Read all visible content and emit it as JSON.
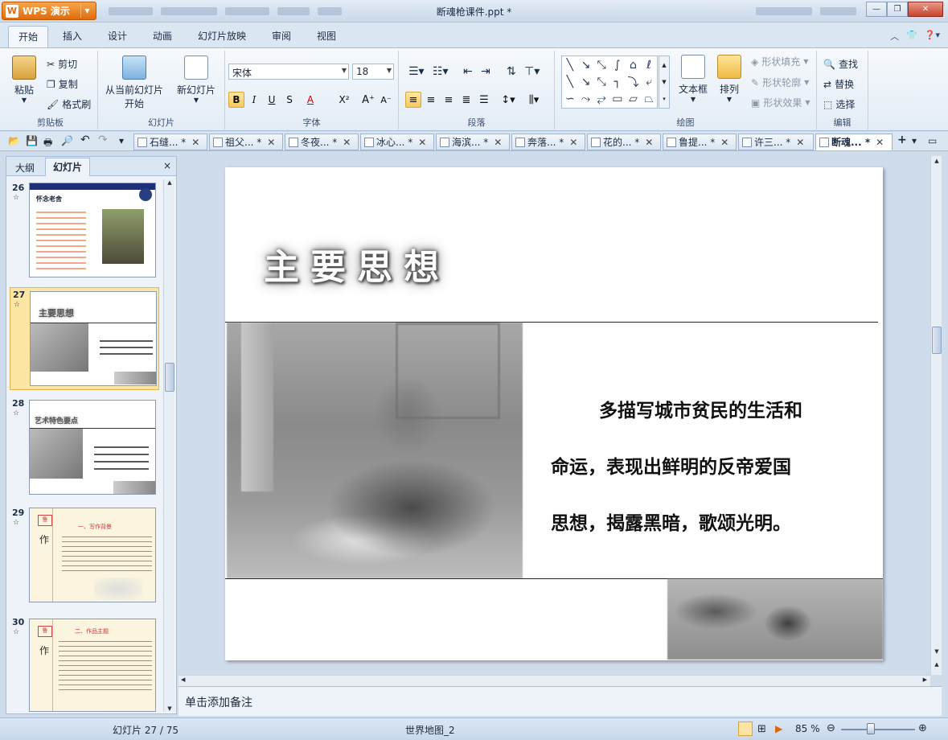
{
  "titlebar": {
    "app_button": "WPS 演示",
    "document_title": "断魂枪课件.ppt *"
  },
  "menu": {
    "tabs": [
      "开始",
      "插入",
      "设计",
      "动画",
      "幻灯片放映",
      "审阅",
      "视图"
    ]
  },
  "ribbon": {
    "clipboard": {
      "paste": "粘贴",
      "cut": "剪切",
      "copy": "复制",
      "format_painter": "格式刷",
      "label": "剪贴板"
    },
    "slides": {
      "from_current": "从当前幻灯片",
      "from_current_2": "开始",
      "new_slide": "新幻灯片",
      "label": "幻灯片"
    },
    "font": {
      "name": "宋体",
      "size": "18",
      "label": "字体",
      "bold": "B",
      "italic": "I",
      "underline": "U",
      "strike": "S",
      "color": "A",
      "superscript": "X²",
      "grow": "A⁺",
      "shrink": "A⁻"
    },
    "paragraph": {
      "label": "段落"
    },
    "drawing": {
      "textbox": "文本框",
      "arrange": "排列",
      "shape_fill": "形状填充",
      "shape_outline": "形状轮廓",
      "shape_effect": "形状效果",
      "label": "绘图"
    },
    "edit": {
      "find": "查找",
      "replace": "替换",
      "select": "选择",
      "label": "编辑"
    }
  },
  "doc_tabs": [
    {
      "label": "石缝... *"
    },
    {
      "label": "祖父... *"
    },
    {
      "label": "冬夜... *"
    },
    {
      "label": "冰心... *"
    },
    {
      "label": "海滨... *"
    },
    {
      "label": "奔落... *"
    },
    {
      "label": "花的... *"
    },
    {
      "label": "鲁提... *"
    },
    {
      "label": "许三... *"
    },
    {
      "label": "断魂... *"
    }
  ],
  "left_pane": {
    "tab_outline": "大纲",
    "tab_slides": "幻灯片",
    "close": "×",
    "slides": [
      {
        "num": "26",
        "title": "怀念老舍",
        "star": "☆"
      },
      {
        "num": "27",
        "title": "主要思想",
        "star": "☆"
      },
      {
        "num": "28",
        "title": "艺术特色要点",
        "star": "☆"
      },
      {
        "num": "29",
        "title": "一、写作背景",
        "star": "☆"
      },
      {
        "num": "30",
        "title": "二、作品主题",
        "star": "☆"
      }
    ]
  },
  "slide": {
    "title": "主要思想",
    "line1": "多描写城市贫民的生活和",
    "line2": "命运，表现出鲜明的反帝爱国",
    "line3": "思想，揭露黑暗，歌颂光明。"
  },
  "notes": {
    "placeholder": "单击添加备注"
  },
  "status": {
    "slide_counter": "幻灯片 27 / 75",
    "theme": "世界地图_2",
    "zoom": "85 %"
  }
}
